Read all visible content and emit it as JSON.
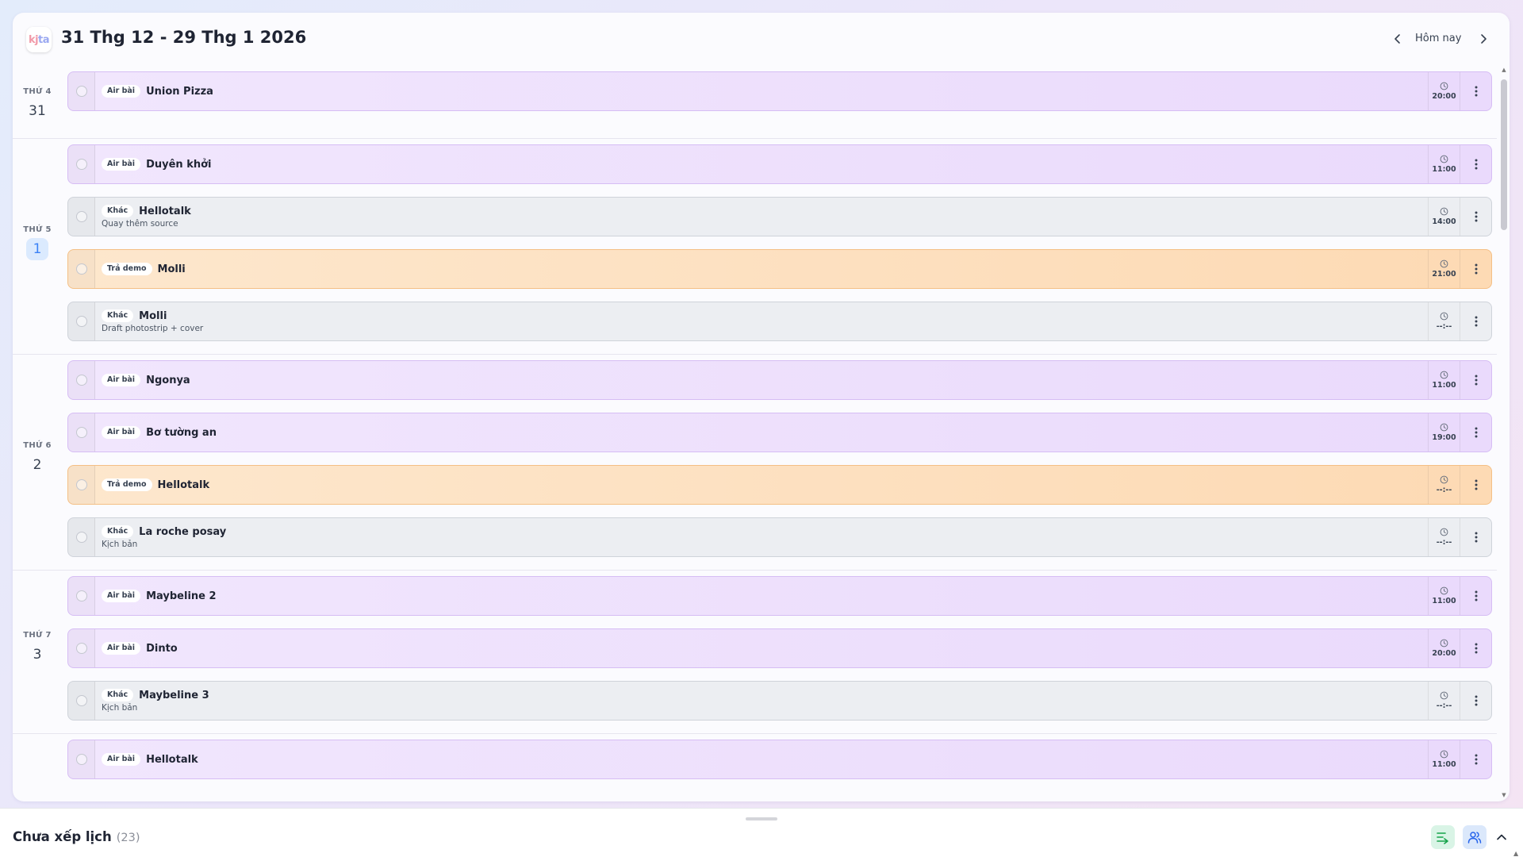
{
  "header": {
    "logo_parts": [
      "kj",
      "ta"
    ],
    "title": "31 Thg 12 - 29 Thg 1 2026",
    "today_label": "Hôm nay"
  },
  "days": [
    {
      "weekday": "THỨ 4",
      "day": "31",
      "today": false,
      "tasks": [
        {
          "kind": "air",
          "tag": "Air bài",
          "title": "Union Pizza",
          "subtitle": "",
          "time": "20:00"
        }
      ]
    },
    {
      "weekday": "THỨ 5",
      "day": "1",
      "today": true,
      "tasks": [
        {
          "kind": "air",
          "tag": "Air bài",
          "title": "Duyên khởi",
          "subtitle": "",
          "time": "11:00"
        },
        {
          "kind": "khac",
          "tag": "Khác",
          "title": "Hellotalk",
          "subtitle": "Quay thêm source",
          "time": "14:00"
        },
        {
          "kind": "demo",
          "tag": "Trả demo",
          "title": "Molli",
          "subtitle": "",
          "time": "21:00"
        },
        {
          "kind": "khac",
          "tag": "Khác",
          "title": "Molli",
          "subtitle": "Draft photostrip + cover",
          "time": "--:--"
        }
      ]
    },
    {
      "weekday": "THỨ 6",
      "day": "2",
      "today": false,
      "tasks": [
        {
          "kind": "air",
          "tag": "Air bài",
          "title": "Ngonya",
          "subtitle": "",
          "time": "11:00"
        },
        {
          "kind": "air",
          "tag": "Air bài",
          "title": "Bơ tường an",
          "subtitle": "",
          "time": "19:00"
        },
        {
          "kind": "demo",
          "tag": "Trả demo",
          "title": "Hellotalk",
          "subtitle": "",
          "time": "--:--"
        },
        {
          "kind": "khac",
          "tag": "Khác",
          "title": "La roche posay",
          "subtitle": "Kịch bản",
          "time": "--:--"
        }
      ]
    },
    {
      "weekday": "THỨ 7",
      "day": "3",
      "today": false,
      "tasks": [
        {
          "kind": "air",
          "tag": "Air bài",
          "title": "Maybeline 2",
          "subtitle": "",
          "time": "11:00"
        },
        {
          "kind": "air",
          "tag": "Air bài",
          "title": "Dinto",
          "subtitle": "",
          "time": "20:00"
        },
        {
          "kind": "khac",
          "tag": "Khác",
          "title": "Maybeline 3",
          "subtitle": "Kịch bản",
          "time": "--:--"
        }
      ]
    },
    {
      "weekday": "",
      "day": "",
      "today": false,
      "tasks": [
        {
          "kind": "air",
          "tag": "Air bài",
          "title": "Hellotalk",
          "subtitle": "",
          "time": "11:00"
        }
      ]
    }
  ],
  "unscheduled": {
    "title": "Chưa xếp lịch",
    "count": "(23)"
  },
  "colors": {
    "air_bg": "#efe3fd",
    "khac_bg": "#eceef2",
    "demo_bg": "#fde2c2",
    "accent_today": "#3b82f6"
  },
  "icons": {
    "prev": "chevron-left-icon",
    "next": "chevron-right-icon",
    "time": "clock-icon",
    "more": "more-vertical-icon",
    "schedule": "list-arrow-icon",
    "users": "users-icon",
    "collapse": "chevron-up-icon"
  }
}
